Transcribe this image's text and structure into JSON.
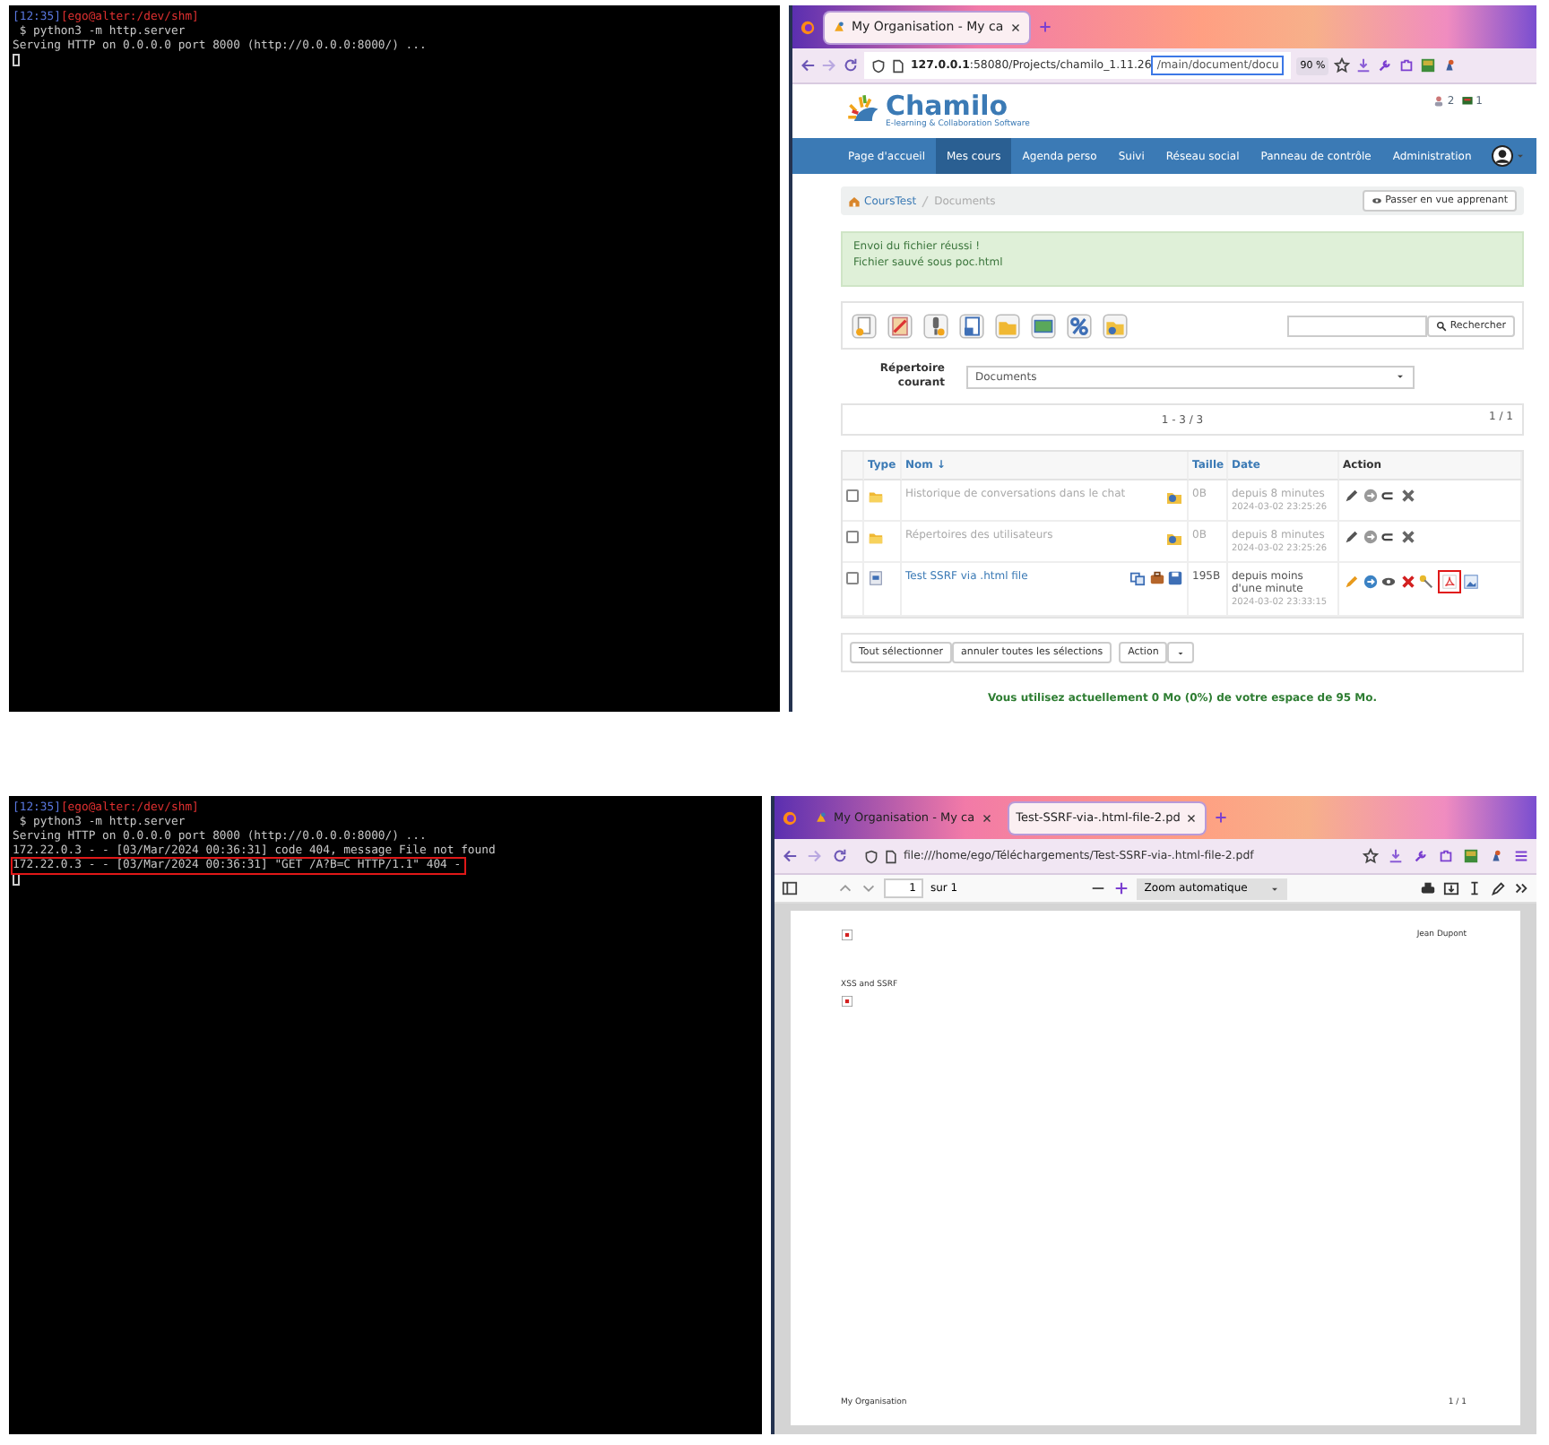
{
  "top_terminal": {
    "prompt_time": "[12:35]",
    "prompt_path": "[ego@alter:/dev/shm]",
    "lines": [
      {
        "text": " $ python3 -m http.server",
        "annotated": false
      },
      {
        "text": "Serving HTTP on 0.0.0.0 port 8000 (http://0.0.0.0:8000/) ...",
        "annotated": false
      }
    ]
  },
  "top_browser": {
    "tabs": [
      {
        "label": "My Organisation - My ca",
        "selected": true
      }
    ],
    "url": {
      "host": "127.0.0.1",
      "path": ":58080/Projects/chamilo_1.11.26",
      "selected_part": "/main/document/docu"
    },
    "zoom": "90 %",
    "header_counts": [
      "2",
      "1"
    ],
    "logo": {
      "name": "Chamilo",
      "tagline": "E-learning & Collaboration Software"
    },
    "nav": [
      {
        "label": "Page d'accueil",
        "selected": false
      },
      {
        "label": "Mes cours",
        "selected": true
      },
      {
        "label": "Agenda perso",
        "selected": false
      },
      {
        "label": "Suivi",
        "selected": false
      },
      {
        "label": "Réseau social",
        "selected": false
      },
      {
        "label": "Panneau de contrôle",
        "selected": false
      },
      {
        "label": "Administration",
        "selected": false
      }
    ],
    "breadcrumb": [
      "CoursTest",
      "Documents"
    ],
    "student_view_button": "Passer en vue apprenant",
    "alert": [
      "Envoi du fichier réussi !",
      "Fichier sauvé sous poc.html"
    ],
    "search_button": "Rechercher",
    "directory": {
      "label": "Répertoire courant",
      "value": "Documents"
    },
    "pagination": {
      "range": "1 - 3 / 3",
      "pages": "1 / 1"
    },
    "table": {
      "columns": [
        "Type",
        "Nom ↓",
        "Taille",
        "Date",
        "Action"
      ],
      "rows": [
        {
          "kind": "folder",
          "name": "Historique de conversations dans le chat",
          "size": "0B",
          "date": "depuis 8 minutes",
          "timestamp": "2024-03-02 23:25:26",
          "visible": false,
          "checked": false
        },
        {
          "kind": "folder",
          "name": "Répertoires des utilisateurs",
          "size": "0B",
          "date": "depuis 8 minutes",
          "timestamp": "2024-03-02 23:25:26",
          "visible": false,
          "checked": false
        },
        {
          "kind": "file",
          "name": "Test SSRF via .html file",
          "size": "195B",
          "date": "depuis moins d'une minute",
          "timestamp": "2024-03-02 23:33:15",
          "visible": true,
          "checked": false,
          "annotated": true
        }
      ]
    },
    "table_buttons": [
      "Tout sélectionner",
      "annuler toutes les sélections",
      "Action"
    ],
    "quota": "Vous utilisez actuellement 0 Mo (0%) de votre espace de 95 Mo."
  },
  "bottom_terminal": {
    "prompt_time": "[12:35]",
    "prompt_path": "[ego@alter:/dev/shm]",
    "lines": [
      {
        "text": " $ python3 -m http.server",
        "annotated": false
      },
      {
        "text": "Serving HTTP on 0.0.0.0 port 8000 (http://0.0.0.0:8000/) ...",
        "annotated": false
      },
      {
        "text": "172.22.0.3 - - [03/Mar/2024 00:36:31] code 404, message File not found",
        "annotated": false
      },
      {
        "text": "172.22.0.3 - - [03/Mar/2024 00:36:31] \"GET /A?B=C HTTP/1.1\" 404 -",
        "annotated": true
      }
    ]
  },
  "bottom_browser": {
    "tabs": [
      {
        "label": "My Organisation - My ca",
        "selected": false
      },
      {
        "label": "Test-SSRF-via-.html-file-2.pd",
        "selected": true
      }
    ],
    "url": "file:///home/ego/Téléchargements/Test-SSRF-via-.html-file-2.pdf",
    "pdf_toolbar": {
      "page": "1",
      "page_count": "sur 1",
      "zoom": "Zoom automatique"
    },
    "document": {
      "author": "Jean Dupont",
      "body": "XSS and SSRF",
      "footer": "My Organisation",
      "page_number": "1 / 1"
    }
  }
}
